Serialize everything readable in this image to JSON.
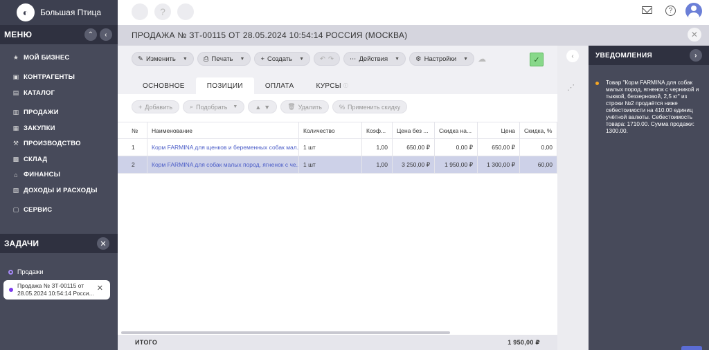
{
  "app": {
    "name": "Большая Птица"
  },
  "sidebar": {
    "menu_title": "МЕНЮ",
    "items": [
      {
        "label": "МОЙ БИЗНЕС",
        "icon": "star-icon"
      },
      {
        "label": "КОНТРАГЕНТЫ",
        "icon": "briefcase-icon"
      },
      {
        "label": "КАТАЛОГ",
        "icon": "catalog-icon"
      },
      {
        "label": "ПРОДАЖИ",
        "icon": "cart-icon"
      },
      {
        "label": "ЗАКУПКИ",
        "icon": "truck-icon"
      },
      {
        "label": "ПРОИЗВОДСТВО",
        "icon": "factory-icon"
      },
      {
        "label": "СКЛАД",
        "icon": "warehouse-icon"
      },
      {
        "label": "ФИНАНСЫ",
        "icon": "bank-icon"
      },
      {
        "label": "ДОХОДЫ И РАСХОДЫ",
        "icon": "document-icon"
      },
      {
        "label": "СЕРВИС",
        "icon": "service-icon"
      }
    ],
    "tasks_title": "ЗАДАЧИ",
    "task_group": "Продажи",
    "task_card": "Продажа № ЗТ-00115 от 28.05.2024 10:54:14 Росси..."
  },
  "document": {
    "title": "ПРОДАЖА № ЗТ-00115 ОТ 28.05.2024 10:54:14 РОССИЯ (МОСКВА)"
  },
  "toolbar": {
    "edit": "Изменить",
    "print": "Печать",
    "create": "Создать",
    "actions": "Действия",
    "settings": "Настройки"
  },
  "tabs": [
    "ОСНОВНОЕ",
    "ПОЗИЦИИ",
    "ОПЛАТА",
    "КУРСЫ"
  ],
  "subtoolbar": {
    "add": "Добавить",
    "pick": "Подобрать",
    "delete": "Удалить",
    "discount": "Применить скидку"
  },
  "table": {
    "headers": [
      "№",
      "Наименование",
      "Количество",
      "Коэф...",
      "Цена без ...",
      "Скидка на...",
      "Цена",
      "Скидка, %"
    ],
    "rows": [
      [
        "1",
        "Корм FARMINA для щенков и беременных собак мал...",
        "1 шт",
        "1,00",
        "650,00 ₽",
        "0,00 ₽",
        "650,00 ₽",
        "0,00"
      ],
      [
        "2",
        "Корм FARMINA для собак малых пород, ягненок с че...",
        "1 шт",
        "1,00",
        "3 250,00 ₽",
        "1 950,00 ₽",
        "1 300,00 ₽",
        "60,00"
      ]
    ]
  },
  "totals": {
    "label": "ИТОГО",
    "value": "1 950,00 ₽"
  },
  "notifications": {
    "title": "УВЕДОМЛЕНИЯ",
    "message": "Товар \"Корм FARMINA для собак малых пород, ягненок с черникой и тыквой, беззерновой, 2,5 кг\" из строки №2 продаётся ниже себестоимости на 410.00 единиц учётной валюты. Себестоимость товара: 1710.00. Сумма продажи: 1300.00."
  }
}
